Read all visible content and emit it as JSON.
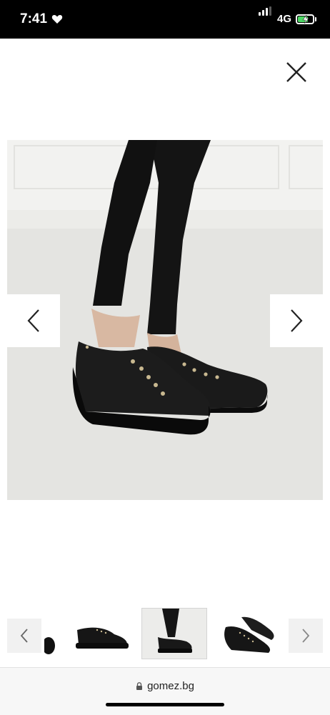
{
  "status_bar": {
    "time": "7:41",
    "network": "4G",
    "battery_level": 0.72,
    "battery_color": "#4cd964"
  },
  "viewer": {
    "close_icon": "close-icon",
    "prev_icon": "chevron-left-icon",
    "next_icon": "chevron-right-icon",
    "active_thumbnail": 2,
    "thumbnail_count": 3
  },
  "browser": {
    "url": "gomez.bg",
    "lock_icon": "lock-icon"
  }
}
